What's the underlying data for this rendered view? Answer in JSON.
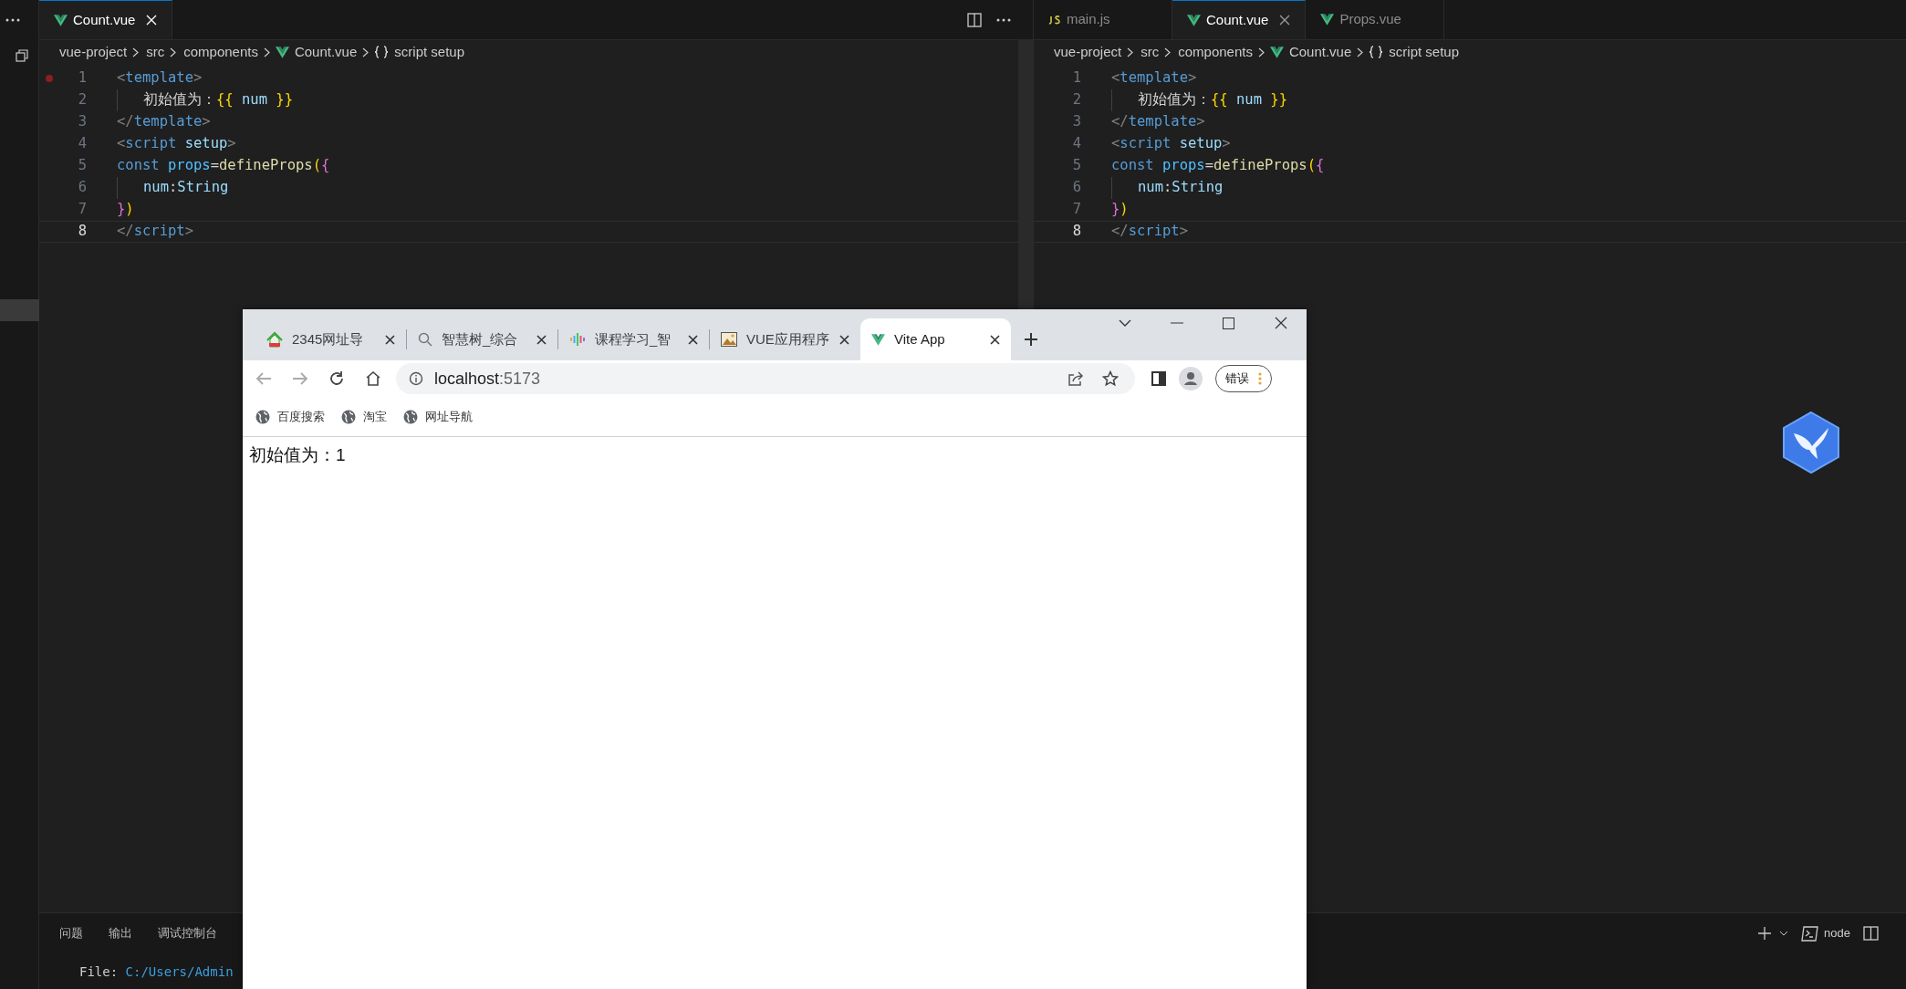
{
  "editors": [
    {
      "tabs": [
        {
          "label": "Count.vue",
          "kind": "vue",
          "selected": true
        }
      ],
      "breadcrumb": [
        {
          "text": "vue-project",
          "kind": "folder"
        },
        {
          "text": "src",
          "kind": "folder"
        },
        {
          "text": "components",
          "kind": "folder"
        },
        {
          "text": "Count.vue",
          "kind": "vuefile"
        },
        {
          "text": "script setup",
          "kind": "symbol"
        }
      ],
      "lines": [
        {
          "number": "1",
          "breakpoint": true,
          "current": false,
          "indent": false,
          "tokens": [
            {
              "text": "<",
              "kind": "punct"
            },
            {
              "text": "template",
              "kind": "tag"
            },
            {
              "text": ">",
              "kind": "punct"
            }
          ]
        },
        {
          "number": "2",
          "breakpoint": false,
          "current": false,
          "indent": true,
          "tokens": [
            {
              "text": "初始值为：",
              "kind": "text"
            },
            {
              "text": "{{",
              "kind": "brace1"
            },
            {
              "text": " num ",
              "kind": "var"
            },
            {
              "text": "}}",
              "kind": "brace1"
            }
          ]
        },
        {
          "number": "3",
          "breakpoint": false,
          "current": false,
          "indent": false,
          "tokens": [
            {
              "text": "</",
              "kind": "punct"
            },
            {
              "text": "template",
              "kind": "tag"
            },
            {
              "text": ">",
              "kind": "punct"
            }
          ]
        },
        {
          "number": "4",
          "breakpoint": false,
          "current": false,
          "indent": false,
          "tokens": [
            {
              "text": "<",
              "kind": "punct"
            },
            {
              "text": "script",
              "kind": "tag"
            },
            {
              "text": " setup",
              "kind": "var"
            },
            {
              "text": ">",
              "kind": "punct"
            }
          ]
        },
        {
          "number": "5",
          "breakpoint": false,
          "current": false,
          "indent": false,
          "tokens": [
            {
              "text": "const",
              "kind": "keyword"
            },
            {
              "text": " props",
              "kind": "const"
            },
            {
              "text": "=",
              "kind": "text"
            },
            {
              "text": "defineProps",
              "kind": "func"
            },
            {
              "text": "(",
              "kind": "brace1"
            },
            {
              "text": "{",
              "kind": "brace2"
            }
          ]
        },
        {
          "number": "6",
          "breakpoint": false,
          "current": false,
          "indent": true,
          "tokens": [
            {
              "text": "num",
              "kind": "var"
            },
            {
              "text": ":",
              "kind": "text"
            },
            {
              "text": "String",
              "kind": "var"
            }
          ]
        },
        {
          "number": "7",
          "breakpoint": false,
          "current": false,
          "indent": false,
          "tokens": [
            {
              "text": "}",
              "kind": "brace2"
            },
            {
              "text": ")",
              "kind": "brace1"
            }
          ]
        },
        {
          "number": "8",
          "breakpoint": false,
          "current": true,
          "indent": false,
          "tokens": [
            {
              "text": "</",
              "kind": "punct"
            },
            {
              "text": "script",
              "kind": "tag"
            },
            {
              "text": ">",
              "kind": "punct"
            }
          ]
        }
      ]
    },
    {
      "tabs": [
        {
          "label": "main.js",
          "kind": "js",
          "selected": false
        },
        {
          "label": "Count.vue",
          "kind": "vue",
          "selected": true
        },
        {
          "label": "Props.vue",
          "kind": "vue",
          "selected": false
        }
      ],
      "breadcrumb": [
        {
          "text": "vue-project",
          "kind": "folder"
        },
        {
          "text": "src",
          "kind": "folder"
        },
        {
          "text": "components",
          "kind": "folder"
        },
        {
          "text": "Count.vue",
          "kind": "vuefile"
        },
        {
          "text": "script setup",
          "kind": "symbol"
        }
      ],
      "lines": [
        {
          "number": "1",
          "breakpoint": false,
          "current": false,
          "indent": false,
          "tokens": [
            {
              "text": "<",
              "kind": "punct"
            },
            {
              "text": "template",
              "kind": "tag"
            },
            {
              "text": ">",
              "kind": "punct"
            }
          ]
        },
        {
          "number": "2",
          "breakpoint": false,
          "current": false,
          "indent": true,
          "tokens": [
            {
              "text": "初始值为：",
              "kind": "text"
            },
            {
              "text": "{{",
              "kind": "brace1"
            },
            {
              "text": " num ",
              "kind": "var"
            },
            {
              "text": "}}",
              "kind": "brace1"
            }
          ]
        },
        {
          "number": "3",
          "breakpoint": false,
          "current": false,
          "indent": false,
          "tokens": [
            {
              "text": "</",
              "kind": "punct"
            },
            {
              "text": "template",
              "kind": "tag"
            },
            {
              "text": ">",
              "kind": "punct"
            }
          ]
        },
        {
          "number": "4",
          "breakpoint": false,
          "current": false,
          "indent": false,
          "tokens": [
            {
              "text": "<",
              "kind": "punct"
            },
            {
              "text": "script",
              "kind": "tag"
            },
            {
              "text": " setup",
              "kind": "var"
            },
            {
              "text": ">",
              "kind": "punct"
            }
          ]
        },
        {
          "number": "5",
          "breakpoint": false,
          "current": false,
          "indent": false,
          "tokens": [
            {
              "text": "const",
              "kind": "keyword"
            },
            {
              "text": " props",
              "kind": "const"
            },
            {
              "text": "=",
              "kind": "text"
            },
            {
              "text": "defineProps",
              "kind": "func"
            },
            {
              "text": "(",
              "kind": "brace1"
            },
            {
              "text": "{",
              "kind": "brace2"
            }
          ]
        },
        {
          "number": "6",
          "breakpoint": false,
          "current": false,
          "indent": true,
          "tokens": [
            {
              "text": "num",
              "kind": "var"
            },
            {
              "text": ":",
              "kind": "text"
            },
            {
              "text": "String",
              "kind": "var"
            }
          ]
        },
        {
          "number": "7",
          "breakpoint": false,
          "current": false,
          "indent": false,
          "tokens": [
            {
              "text": "}",
              "kind": "brace2"
            },
            {
              "text": ")",
              "kind": "brace1"
            }
          ]
        },
        {
          "number": "8",
          "breakpoint": false,
          "current": true,
          "indent": false,
          "tokens": [
            {
              "text": "</",
              "kind": "punct"
            },
            {
              "text": "script",
              "kind": "tag"
            },
            {
              "text": ">",
              "kind": "punct"
            }
          ]
        }
      ]
    }
  ],
  "panel": {
    "tabs": [
      "问题",
      "输出",
      "调试控制台"
    ],
    "terminal": {
      "label": "File: ",
      "path": "C:/Users/Admin"
    },
    "shell": "node"
  },
  "browser": {
    "tabs": [
      {
        "title": "2345网址导",
        "kind": "house",
        "selected": false
      },
      {
        "title": "智慧树_综合",
        "kind": "search",
        "selected": false
      },
      {
        "title": "课程学习_智",
        "kind": "bars",
        "selected": false
      },
      {
        "title": "VUE应用程序",
        "kind": "image",
        "selected": false
      },
      {
        "title": "Vite App",
        "kind": "vue",
        "selected": true
      }
    ],
    "address": {
      "host": "localhost",
      "port": ":5173"
    },
    "error_button": "错误",
    "bookmarks": [
      "百度搜索",
      "淘宝",
      "网址导航"
    ],
    "content": "初始值为：1"
  }
}
